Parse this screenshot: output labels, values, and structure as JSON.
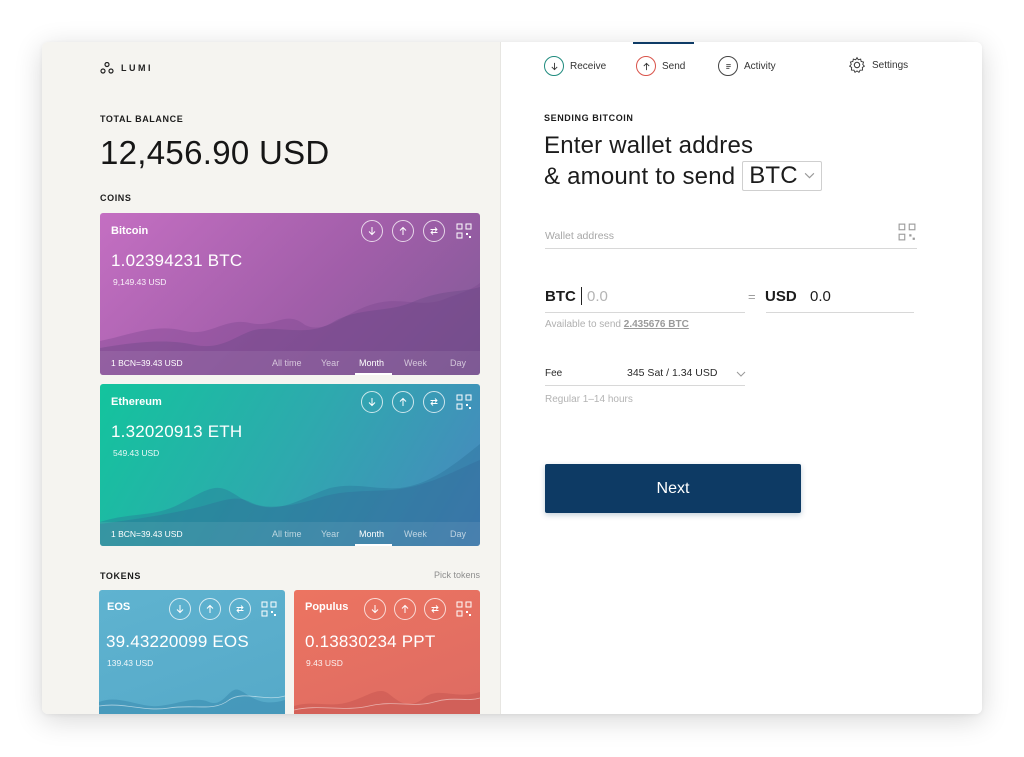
{
  "app": {
    "brand": "LUMI"
  },
  "balance": {
    "label": "TOTAL BALANCE",
    "amount": "12,456.90 USD"
  },
  "coins": {
    "label": "COINS",
    "ranges": [
      "All time",
      "Year",
      "Month",
      "Week",
      "Day"
    ],
    "active_range": "Month",
    "items": [
      {
        "name": "Bitcoin",
        "amount": "1.02394231 BTC",
        "fiat": "9,149.43 USD",
        "rate": "1 BCN=39.43 USD",
        "gradient_from": "#b968bd",
        "gradient_to": "#8a5b98"
      },
      {
        "name": "Ethereum",
        "amount": "1.32020913 ETH",
        "fiat": "549.43 USD",
        "rate": "1 BCN=39.43 USD",
        "gradient_from": "#16c2a0",
        "gradient_to": "#4687bf"
      }
    ]
  },
  "tokens": {
    "label": "TOKENS",
    "pick_label": "Pick tokens",
    "items": [
      {
        "name": "EOS",
        "amount": "39.43220099 EOS",
        "fiat": "139.43 USD",
        "color": "#5ab0cf"
      },
      {
        "name": "Populus",
        "amount": "0.13830234 PPT",
        "fiat": "9.43 USD",
        "color": "#ea6f5a"
      }
    ]
  },
  "nav": {
    "receive": "Receive",
    "send": "Send",
    "activity": "Activity",
    "settings": "Settings",
    "active": "Send"
  },
  "send_form": {
    "section_label": "SENDING BITCOIN",
    "heading_line1": "Enter wallet addres",
    "heading_line2": "& amount to send",
    "coin_selected": "BTC",
    "wallet_placeholder": "Wallet address",
    "amount_currency": "BTC",
    "amount_value": "0.0",
    "equals": "=",
    "fiat_currency": "USD",
    "fiat_value": "0.0",
    "available_prefix": "Available to send",
    "available_amount": "2.435676 BTC",
    "fee_label": "Fee",
    "fee_value": "345 Sat / 1.34 USD",
    "fee_hint": "Regular 1–14 hours",
    "next_label": "Next"
  },
  "colors": {
    "accent": "#0d3a64",
    "left_bg": "#f5f4f0"
  }
}
